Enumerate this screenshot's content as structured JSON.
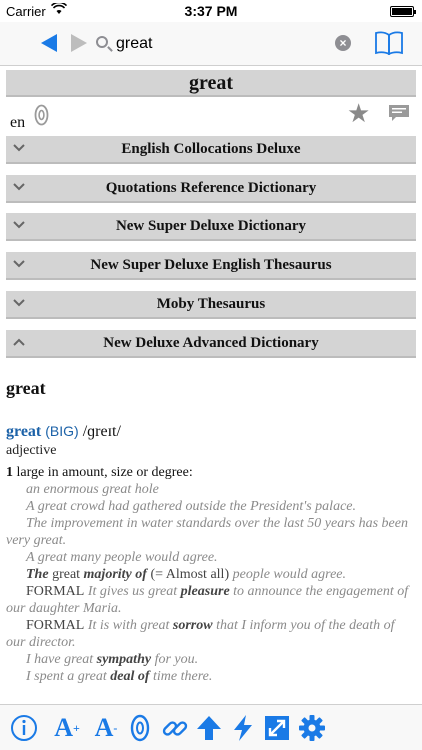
{
  "status": {
    "carrier": "Carrier",
    "time": "3:37 PM"
  },
  "search": {
    "query": "great"
  },
  "entry": {
    "headword": "great",
    "language": "en"
  },
  "sections": [
    {
      "title": "English Collocations Deluxe",
      "expanded": false
    },
    {
      "title": "Quotations Reference Dictionary",
      "expanded": false
    },
    {
      "title": "New Super Deluxe Dictionary",
      "expanded": false
    },
    {
      "title": "New Super Deluxe English Thesaurus",
      "expanded": false
    },
    {
      "title": "Moby Thesaurus",
      "expanded": false
    },
    {
      "title": "New Deluxe Advanced Dictionary",
      "expanded": true
    }
  ],
  "definition": {
    "headword": "great",
    "entry_word": "great",
    "guide": "(BIG)",
    "pronunciation": "/ɡreɪt/",
    "part_of_speech": "adjective",
    "sense_number": "1",
    "sense_text": "large in amount, size or degree:",
    "examples": {
      "ex1": "an enormous great hole",
      "ex2": "A great crowd had gathered outside the President's palace.",
      "ex3": "The improvement in water standards over the last 50 years has been very great.",
      "ex4": "A great many people would agree.",
      "ex5_a": "The",
      "ex5_b": " great ",
      "ex5_c": "majority of",
      "ex5_d": " (= Almost all) ",
      "ex5_e": "people would agree.",
      "ex6_a": "FORMAL",
      "ex6_b": " It gives us great ",
      "ex6_c": "pleasure",
      "ex6_d": " to announce the engagement of our daughter Maria.",
      "ex7_a": "FORMAL",
      "ex7_b": " It is with great ",
      "ex7_c": "sorrow",
      "ex7_d": " that I inform you of the death of our director.",
      "ex8_a": "I have great ",
      "ex8_b": "sympathy",
      "ex8_c": " for you.",
      "ex9_a": "I spent a great ",
      "ex9_b": "deal of",
      "ex9_c": " time there."
    }
  },
  "colors": {
    "accent": "#1a7ae6",
    "link": "#1c62a8",
    "section_bg": "#d4d4d4",
    "example": "#8a8a8a"
  },
  "icons": [
    "back-arrow-icon",
    "forward-arrow-icon",
    "search-icon",
    "clear-icon",
    "book-icon",
    "audio-icon",
    "star-icon",
    "note-icon",
    "info-icon",
    "font-increase-icon",
    "font-decrease-icon",
    "pronounce-icon",
    "link-icon",
    "up-arrow-icon",
    "lightning-icon",
    "fullscreen-icon",
    "settings-gear-icon"
  ]
}
